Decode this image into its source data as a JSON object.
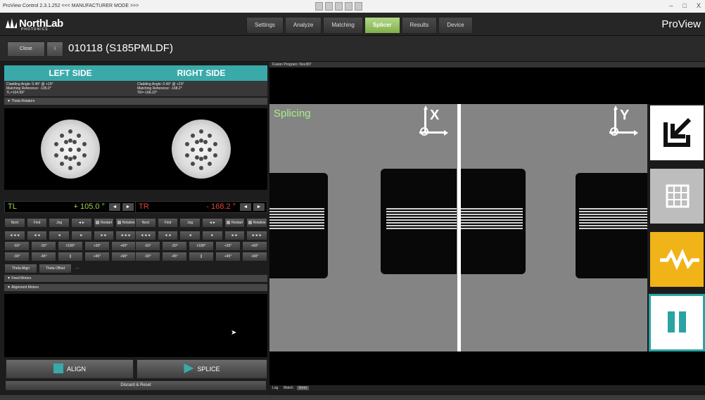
{
  "titlebar": {
    "title": "ProView Control 2.3.1.252 <<< MANUFACTURER MODE >>>",
    "minimize": "–",
    "maximize": "□",
    "close": "X"
  },
  "header": {
    "logo_text": "NorthLab",
    "logo_sub": "PHOTONICS",
    "tabs": [
      {
        "label": "Settings"
      },
      {
        "label": "Analyze"
      },
      {
        "label": "Matching"
      },
      {
        "label": "Splicer"
      },
      {
        "label": "Results"
      },
      {
        "label": "Device"
      }
    ],
    "active_tab": "Splicer",
    "brand": "ProView"
  },
  "program": {
    "close_label": "Close",
    "info_label": "i",
    "title": "010118 (S185PMLDF)"
  },
  "left_side": {
    "title": "LEFT SIDE",
    "info": [
      "Cladding Angle: 0.45° @ +19°",
      "Matching Reference: -105.0°",
      "TL=104.99°"
    ],
    "readout_label": "TL",
    "readout_value": "+ 105.0 °",
    "label_color": "#9dd44a"
  },
  "right_side": {
    "title": "RIGHT SIDE",
    "info": [
      "Cladding Angle: 0.43° @ +23°",
      "Matching Reference: -168.2°",
      "TR=-168.22°"
    ],
    "readout_label": "TR",
    "readout_value": "- 168.2 °",
    "label_color": "#e2453a"
  },
  "sections": {
    "theta_rotators": "Theta Rotators",
    "feed_motors": "Feed Motors",
    "alignment_motors": "Alignment Motors"
  },
  "controls": {
    "row1": [
      "Next",
      "Find",
      "Jog",
      "◄►",
      "Restart",
      "Relative"
    ],
    "row2": [
      "◄◄◄",
      "◄◄",
      "◄",
      "►",
      "►►",
      "►►►"
    ],
    "row3": [
      "-60°",
      "-30°",
      "±180°",
      "+30°",
      "+60°"
    ],
    "row4": [
      "-90°",
      "-45°",
      "||",
      "+45°",
      "+90°"
    ]
  },
  "theta_buttons": [
    "Theta Align",
    "Theta Offset",
    "..."
  ],
  "align_button": "ALIGN",
  "splice_button": "SPLICE",
  "discard_label": "Discard & Reset",
  "fusion_program": "Fusion Program: Nov387",
  "camera": {
    "status": "Splicing",
    "axis_left": "X",
    "axis_right": "Y",
    "status_color": "#a7ef87"
  },
  "log_tabs": [
    "Log",
    "Watch",
    "Error"
  ],
  "side_buttons": [
    {
      "icon": "export-arrow-icon",
      "bg": "#ffffff"
    },
    {
      "icon": "grid-icon",
      "bg": "#bdbdbd"
    },
    {
      "icon": "waveform-icon",
      "bg": "#f0b418"
    },
    {
      "icon": "pause-icon",
      "bg": "#ffffff"
    }
  ],
  "colors": {
    "teal": "#3aa9aa",
    "accent_green": "#7fb048"
  }
}
